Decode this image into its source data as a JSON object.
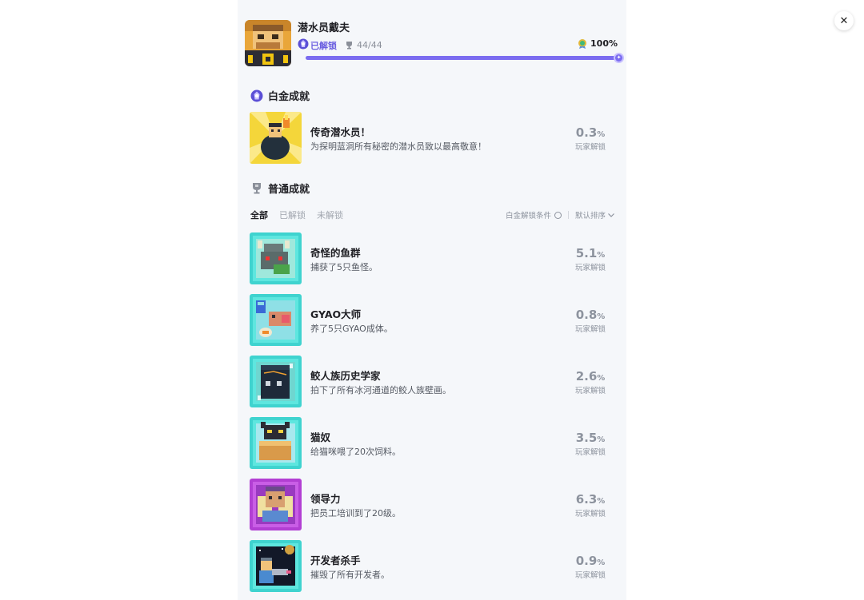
{
  "game": {
    "title": "潜水员戴夫",
    "unlock_label": "已解锁",
    "trophy_count": "44/44",
    "percent": "100%",
    "progress": 1.0
  },
  "platinum": {
    "section_title": "白金成就",
    "item": {
      "name": "传奇潜水员！",
      "desc": "为探明蓝洞所有秘密的潜水员致以最高敬意！",
      "rate": "0.3",
      "unit": "%",
      "rate_label": "玩家解锁"
    }
  },
  "normal": {
    "section_title": "普通成就",
    "tabs": [
      "全部",
      "已解锁",
      "未解锁"
    ],
    "platinum_condition": "白金解锁条件",
    "sort_label": "默认排序",
    "items": [
      {
        "name": "奇怪的鱼群",
        "desc": "捕获了5只鱼怪。",
        "rate": "5.1",
        "unit": "%",
        "rate_label": "玩家解锁"
      },
      {
        "name": "GYAO大师",
        "desc": "养了5只GYAO成体。",
        "rate": "0.8",
        "unit": "%",
        "rate_label": "玩家解锁"
      },
      {
        "name": "鲛人族历史学家",
        "desc": "拍下了所有冰河通道的鲛人族壁画。",
        "rate": "2.6",
        "unit": "%",
        "rate_label": "玩家解锁"
      },
      {
        "name": "猫奴",
        "desc": "给猫咪喂了20次饲料。",
        "rate": "3.5",
        "unit": "%",
        "rate_label": "玩家解锁"
      },
      {
        "name": "领导力",
        "desc": "把员工培训到了20级。",
        "rate": "6.3",
        "unit": "%",
        "rate_label": "玩家解锁"
      },
      {
        "name": "开发者杀手",
        "desc": "摧毁了所有开发者。",
        "rate": "0.9",
        "unit": "%",
        "rate_label": "玩家解锁"
      }
    ]
  },
  "colors": {
    "accent": "#7b6cf0",
    "teal_frame": "#3fd3cf",
    "purple_frame": "#b23fd3"
  },
  "icons": [
    "close-icon",
    "platinum-badge-icon",
    "trophy-icon",
    "medal-icon",
    "chevron-down-icon"
  ]
}
